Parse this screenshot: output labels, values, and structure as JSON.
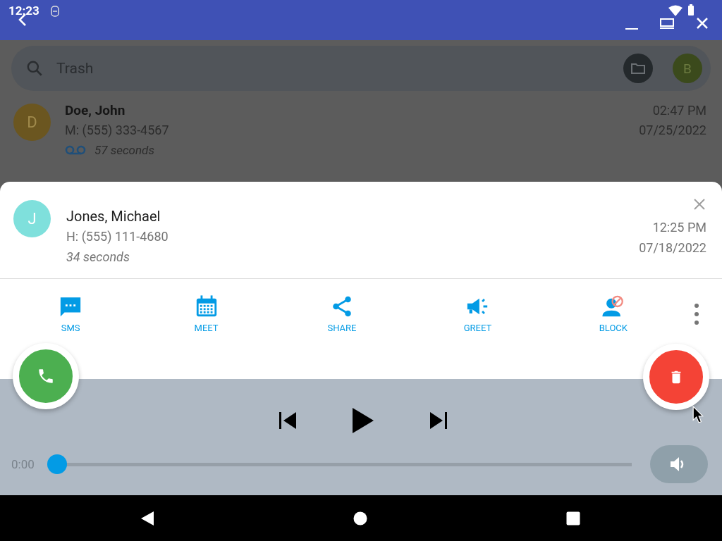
{
  "status_bar": {
    "time": "12:23"
  },
  "search": {
    "value": "Trash",
    "avatar_letter": "B"
  },
  "messages": [
    {
      "initial": "D",
      "color": "#6b5620",
      "name": "Doe, John",
      "phone": "M: (555) 333-4567",
      "duration": "57 seconds",
      "time": "02:47 PM",
      "date": "07/25/2022"
    }
  ],
  "detail": {
    "initial": "J",
    "color": "#7fe0dc",
    "name": "Jones, Michael",
    "phone": "H: (555) 111-4680",
    "duration": "34 seconds",
    "time": "12:25 PM",
    "date": "07/18/2022"
  },
  "actions": [
    {
      "kind": "sms",
      "label": "SMS"
    },
    {
      "kind": "meet",
      "label": "MEET"
    },
    {
      "kind": "share",
      "label": "SHARE"
    },
    {
      "kind": "greet",
      "label": "GREET"
    },
    {
      "kind": "block",
      "label": "BLOCK"
    }
  ],
  "player": {
    "position": "0:00",
    "level": 0
  }
}
